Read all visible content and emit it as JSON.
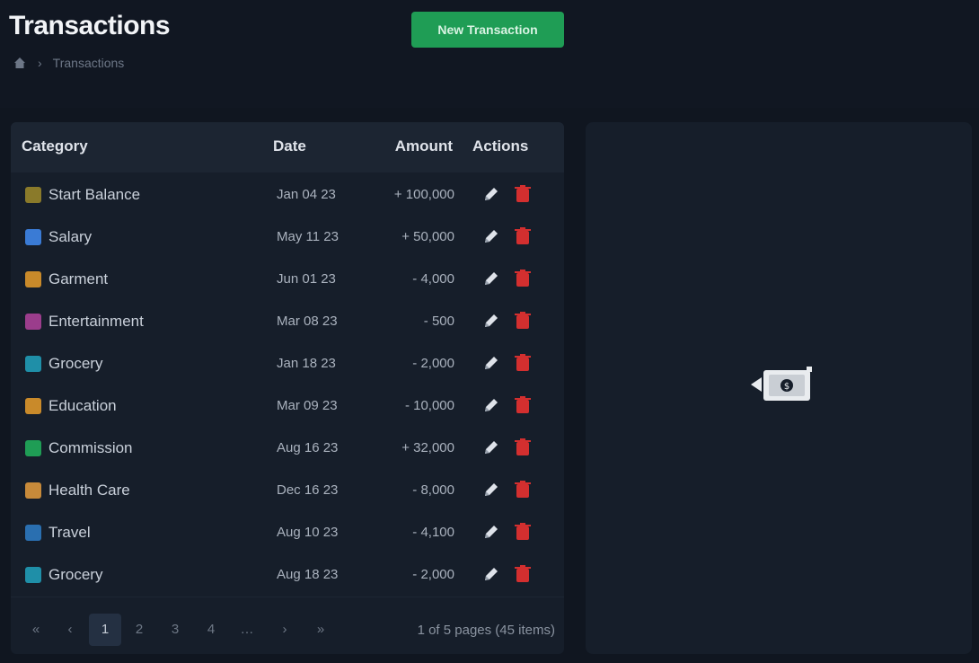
{
  "header": {
    "title": "Transactions",
    "breadcrumb_current": "Transactions",
    "new_button_label": "New Transaction"
  },
  "table": {
    "columns": [
      "Category",
      "Date",
      "Amount",
      "Actions"
    ],
    "rows": [
      {
        "category": "Start Balance",
        "date": "Jan 04 23",
        "amount": "+ 100,000",
        "icon": "star-icon",
        "color": "#8a7a2a"
      },
      {
        "category": "Salary",
        "date": "May 11 23",
        "amount": "+ 50,000",
        "icon": "salary-icon",
        "color": "#3a7bd5"
      },
      {
        "category": "Garment",
        "date": "Jun 01 23",
        "amount": "- 4,000",
        "icon": "shirt-icon",
        "color": "#c98a2a"
      },
      {
        "category": "Entertainment",
        "date": "Mar 08 23",
        "amount": "- 500",
        "icon": "ticket-icon",
        "color": "#9b3d8c"
      },
      {
        "category": "Grocery",
        "date": "Jan 18 23",
        "amount": "- 2,000",
        "icon": "grocery-icon",
        "color": "#1f8fa8"
      },
      {
        "category": "Education",
        "date": "Mar 09 23",
        "amount": "- 10,000",
        "icon": "book-icon",
        "color": "#c98a2a"
      },
      {
        "category": "Commission",
        "date": "Aug 16 23",
        "amount": "+ 32,000",
        "icon": "coin-icon",
        "color": "#1f9d55"
      },
      {
        "category": "Health Care",
        "date": "Dec 16 23",
        "amount": "- 8,000",
        "icon": "health-icon",
        "color": "#c78a3a"
      },
      {
        "category": "Travel",
        "date": "Aug 10 23",
        "amount": "- 4,100",
        "icon": "plane-icon",
        "color": "#2a6fb0"
      },
      {
        "category": "Grocery",
        "date": "Aug 18 23",
        "amount": "- 2,000",
        "icon": "grocery-icon",
        "color": "#1f8fa8"
      }
    ]
  },
  "pagination": {
    "first": "«",
    "prev": "‹",
    "pages": [
      "1",
      "2",
      "3",
      "4",
      "…",
      "›",
      "»"
    ],
    "active_page": "1",
    "info": "1 of 5 pages (45 items)"
  },
  "colors": {
    "accent": "#1f9d55",
    "delete": "#d32f2f"
  }
}
